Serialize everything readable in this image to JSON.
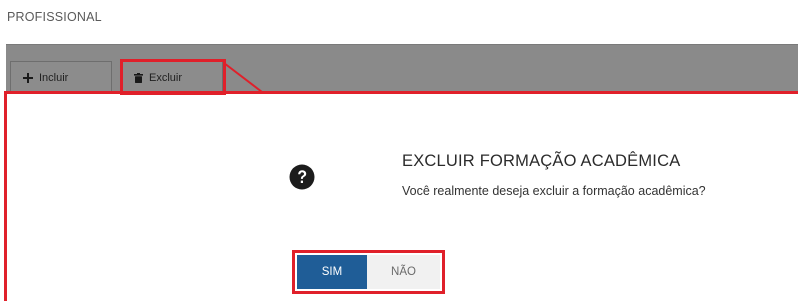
{
  "section": {
    "title": "PROFISSIONAL"
  },
  "toolbar": {
    "incluir_label": "Incluir",
    "excluir_label": "Excluir",
    "icons": {
      "incluir": "plus-icon",
      "excluir": "trash-icon"
    }
  },
  "dialog": {
    "icon": "question-circle-icon",
    "title": "EXCLUIR FORMAÇÃO ACADÊMICA",
    "message": "Você realmente deseja excluir a formação acadêmica?",
    "confirm_label": "SIM",
    "cancel_label": "NÃO"
  },
  "colors": {
    "highlight": "#e0202a",
    "confirm_bg": "#1f5d97",
    "toolbar_bg": "#8a8a8a"
  }
}
